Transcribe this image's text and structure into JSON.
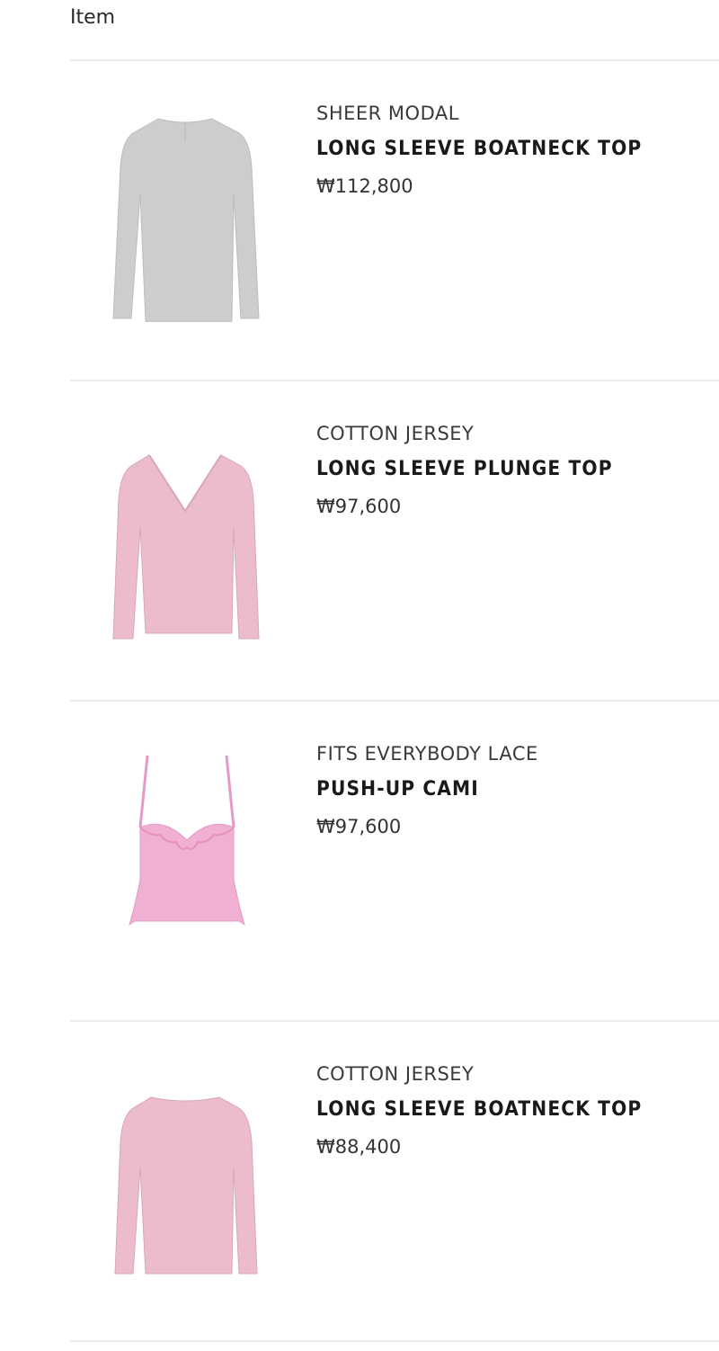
{
  "header": {
    "title": "Item"
  },
  "items": [
    {
      "collection": "SHEER MODAL",
      "name": "LONG SLEEVE BOATNECK TOP",
      "price": "₩112,800",
      "image_icon": "boatneck-top-grey-icon",
      "color": "#c9c9c7"
    },
    {
      "collection": "COTTON JERSEY",
      "name": "LONG SLEEVE PLUNGE TOP",
      "price": "₩97,600",
      "image_icon": "plunge-top-pink-icon",
      "color": "#eab9cc"
    },
    {
      "collection": "FITS EVERYBODY LACE",
      "name": "PUSH-UP CAMI",
      "price": "₩97,600",
      "image_icon": "cami-pink-icon",
      "color": "#efb0d4"
    },
    {
      "collection": "COTTON JERSEY",
      "name": "LONG SLEEVE BOATNECK TOP",
      "price": "₩88,400",
      "image_icon": "boatneck-top-pink-icon",
      "color": "#ecbccd"
    }
  ]
}
